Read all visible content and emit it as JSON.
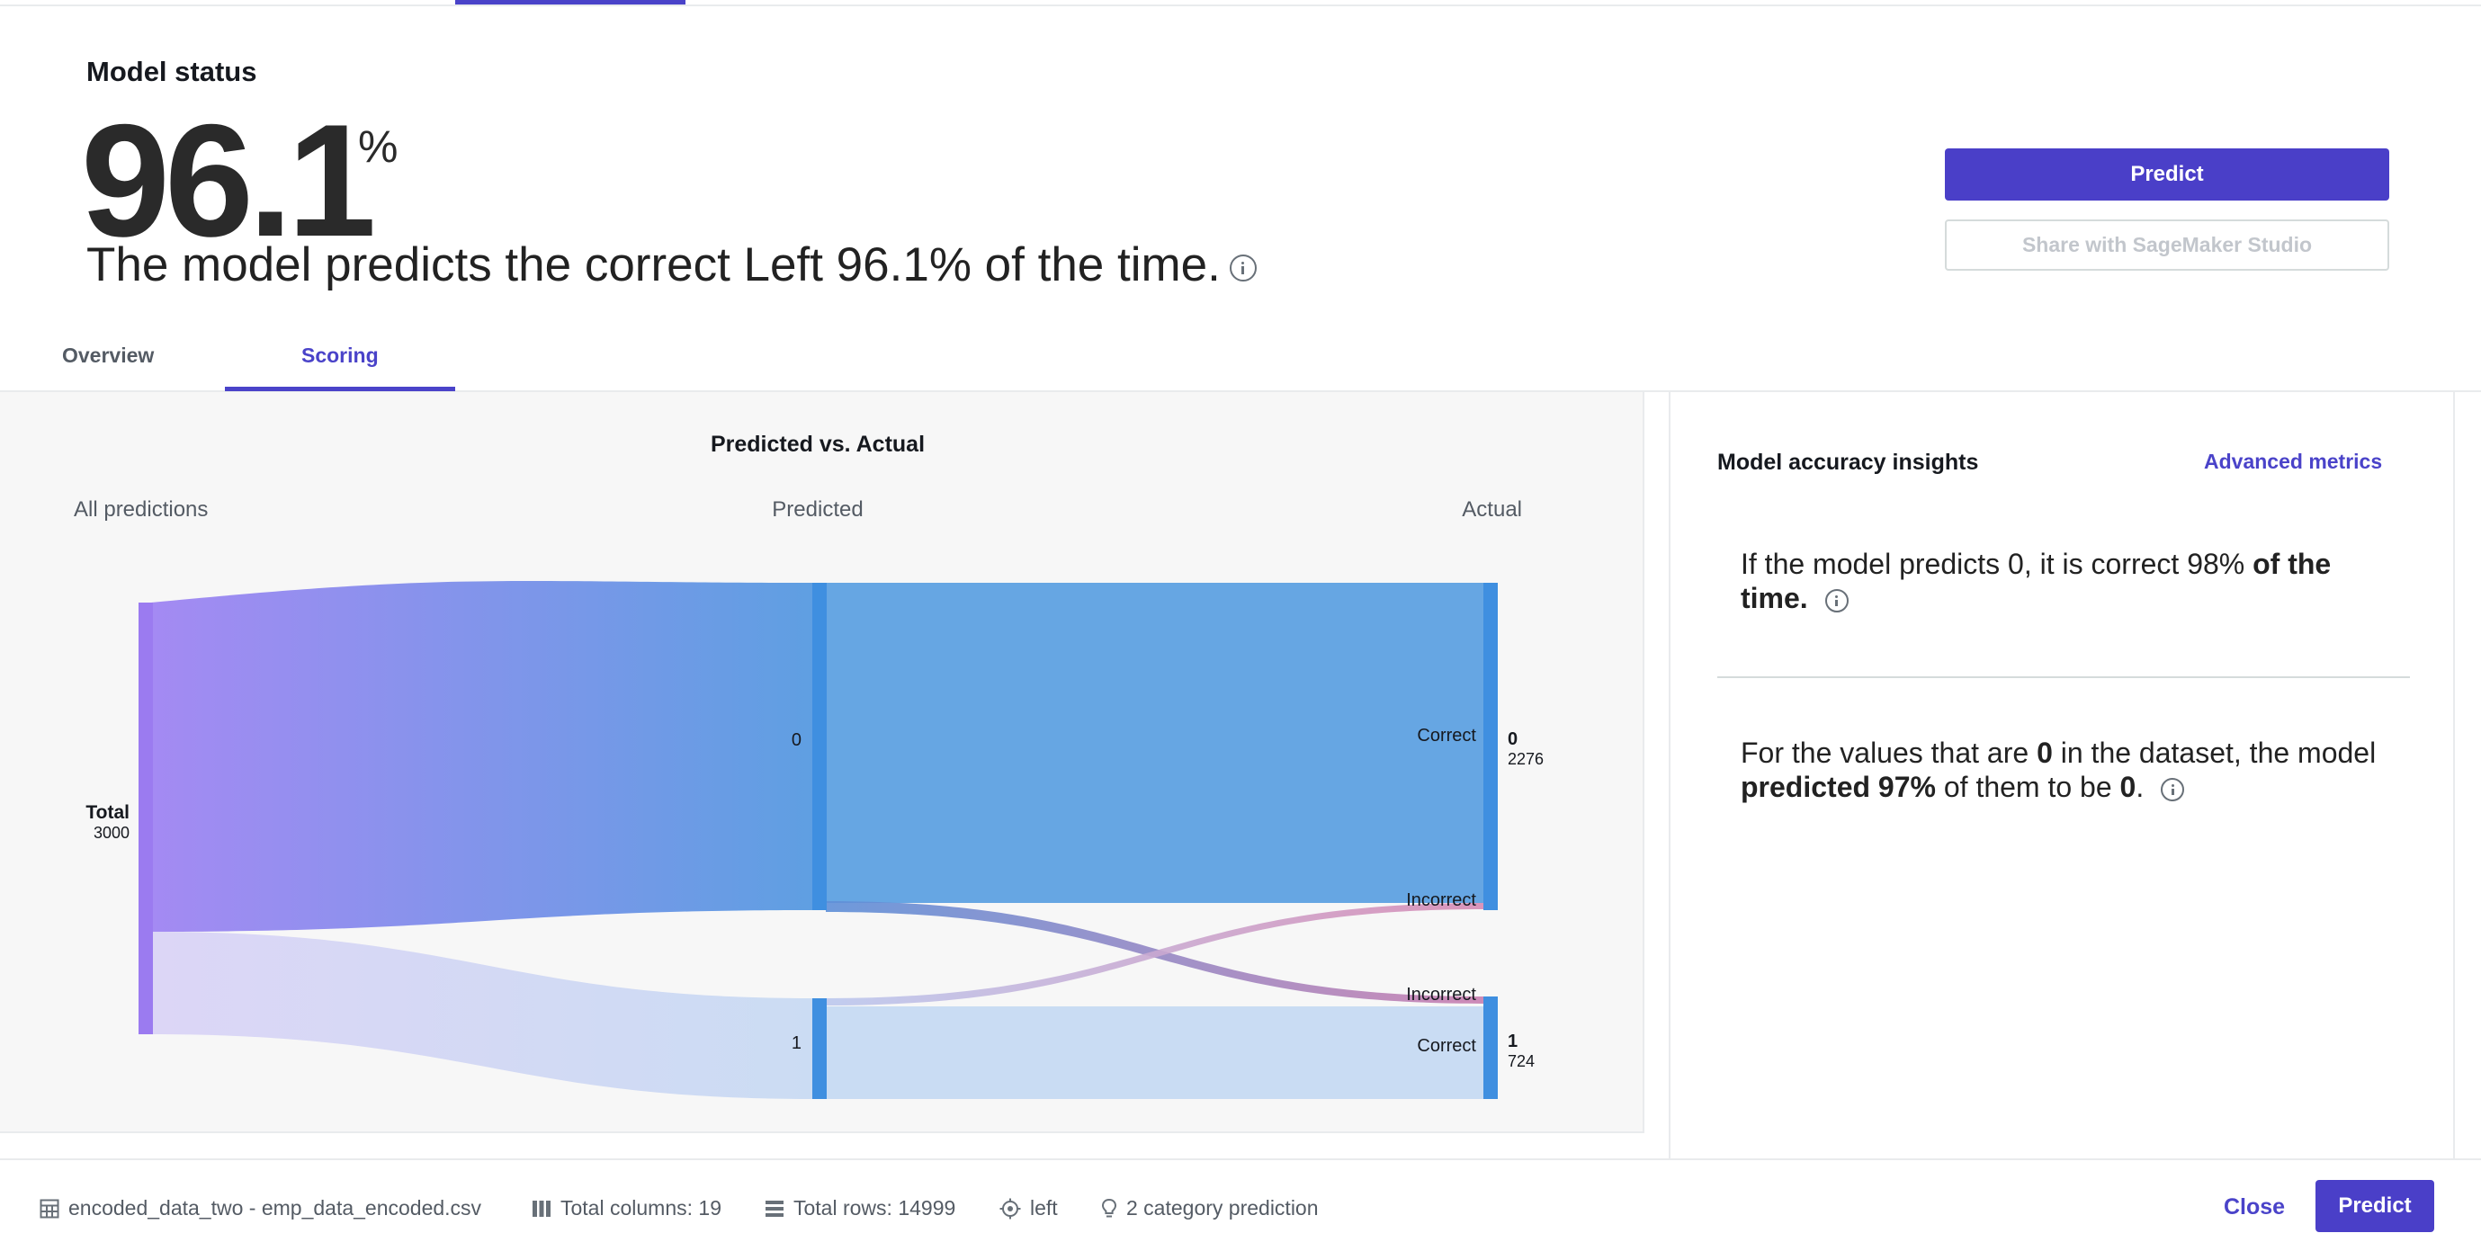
{
  "header": {
    "title": "Model status",
    "score": "96.1",
    "score_unit": "%",
    "headline": "The model predicts the correct Left 96.1% of the time.",
    "predict_label": "Predict",
    "share_label": "Share with SageMaker Studio"
  },
  "tabs": [
    {
      "label": "Overview",
      "active": false
    },
    {
      "label": "Scoring",
      "active": true
    }
  ],
  "chart_data": {
    "type": "sankey",
    "title": "Predicted vs. Actual",
    "column_labels": [
      "All predictions",
      "Predicted",
      "Actual"
    ],
    "total_label": "Total",
    "total_value": "3000",
    "predicted_nodes": [
      "0",
      "1"
    ],
    "actual_nodes": [
      {
        "label": "0",
        "count": "2276"
      },
      {
        "label": "1",
        "count": "724"
      }
    ],
    "flow_labels": {
      "correct": "Correct",
      "incorrect": "Incorrect"
    },
    "colors": {
      "total": "#9b7bf0",
      "node": "#3f8fe0",
      "correct_0": "#66a6e3",
      "correct_1": "#c9dcf3",
      "incorrect": "#d47aa6"
    }
  },
  "insights": {
    "title": "Model accuracy insights",
    "advanced_link": "Advanced metrics",
    "one": {
      "t1": "If the model predicts 0, it is correct 98%",
      "t2": "of the time."
    },
    "two": {
      "t1": "For the values that are",
      "b1": "0",
      "t2": "in the dataset, the model",
      "b2": "predicted 97%",
      "t3": "of them to be",
      "b3": "0",
      "t4": "."
    }
  },
  "footer": {
    "dataset": "encoded_data_two - emp_data_encoded.csv",
    "columns": "Total columns: 19",
    "rows": "Total rows: 14999",
    "target": "left",
    "prediction_type": "2 category prediction",
    "close_label": "Close",
    "predict_label": "Predict"
  }
}
